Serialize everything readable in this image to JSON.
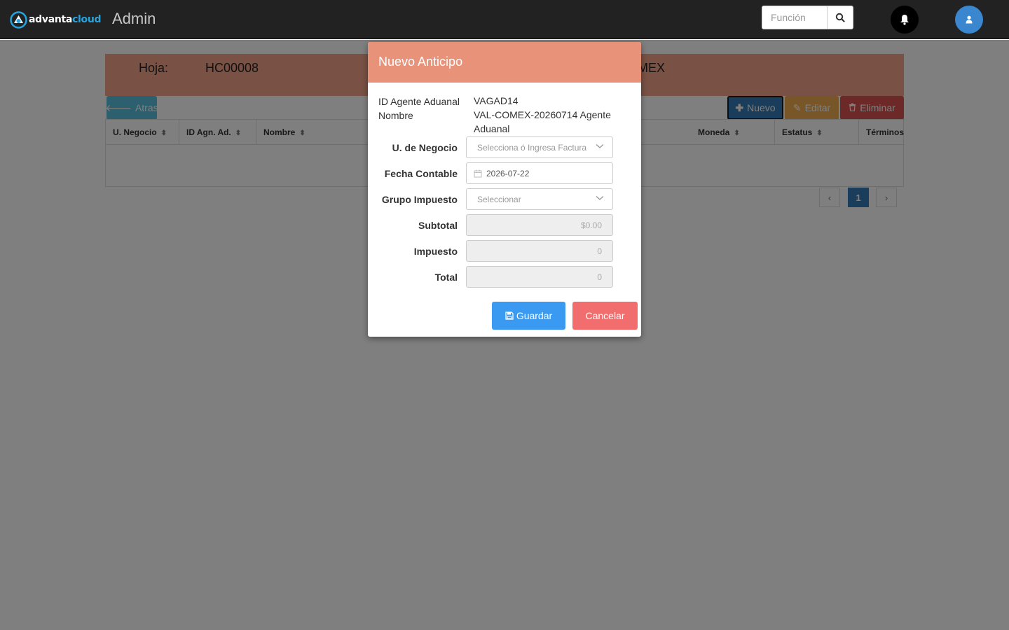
{
  "topbar": {
    "logo_text_a": "advanta",
    "logo_text_b": "cloud",
    "app_title": "Admin",
    "search_placeholder": "Función",
    "brand_color": "#2aa3dc"
  },
  "header_panel": {
    "label": "Hoja:",
    "value": "HC00008",
    "right_fragment": "MEX"
  },
  "toolbar": {
    "atras": "Atras",
    "nuevo": "Nuevo",
    "editar": "Editar",
    "eliminar": "Eliminar"
  },
  "table": {
    "columns": [
      "U. Negocio",
      "ID Agn. Ad.",
      "Nombre",
      "Moneda",
      "Estatus",
      "Términos"
    ]
  },
  "pagination": {
    "current_page": "1"
  },
  "modal": {
    "title": "Nuevo Anticipo",
    "info": {
      "id_label": "ID Agente Aduanal",
      "id_value": "VAGAD14",
      "nombre_label": "Nombre",
      "nombre_value": "VAL-COMEX-20260714 Agente Aduanal"
    },
    "fields": {
      "unidad_negocio_label": "U. de Negocio",
      "unidad_negocio_placeholder": "Selecciona ó Ingresa Factura",
      "fecha_label": "Fecha Contable",
      "fecha_value": "2026-07-22",
      "grupo_label": "Grupo Impuesto",
      "grupo_placeholder": "Seleccionar",
      "subtotal_label": "Subtotal",
      "subtotal_value": "$0.00",
      "impuesto_label": "Impuesto",
      "impuesto_value": "0",
      "total_label": "Total",
      "total_value": "0"
    },
    "buttons": {
      "guardar": "Guardar",
      "cancelar": "Cancelar"
    },
    "header_color": "#e8927a"
  }
}
